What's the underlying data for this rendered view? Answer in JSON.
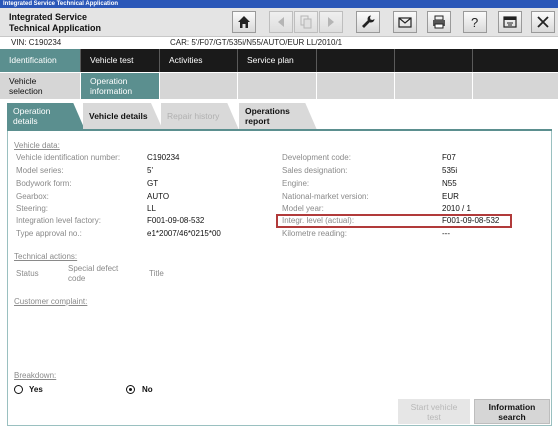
{
  "window": {
    "title": "Integrated Service Technical Application"
  },
  "header": {
    "app_line1": "Integrated Service",
    "app_line2": "Technical Application"
  },
  "vehicle": {
    "vin_text": "VIN:  C190234",
    "car_text": "CAR:  5'/F07/GT/535i/N55/AUTO/EUR LL/2010/1"
  },
  "nav1": [
    "Identification",
    "Vehicle test",
    "Activities",
    "Service plan"
  ],
  "nav2": [
    {
      "line1": "Vehicle",
      "line2": "selection"
    },
    {
      "line1": "Operation",
      "line2": "information"
    }
  ],
  "tabs": [
    {
      "line1": "Operation",
      "line2": "details"
    },
    {
      "line1": "Vehicle details",
      "line2": ""
    },
    {
      "line1": "Repair history",
      "line2": ""
    },
    {
      "line1": "Operations",
      "line2": "report"
    }
  ],
  "vehicle_data": {
    "heading": "Vehicle data:",
    "left": [
      {
        "label": "Vehicle identification number:",
        "value": "C190234"
      },
      {
        "label": "Model series:",
        "value": "5'"
      },
      {
        "label": "Bodywork form:",
        "value": "GT"
      },
      {
        "label": "Gearbox:",
        "value": "AUTO"
      },
      {
        "label": "Steering:",
        "value": "LL"
      },
      {
        "label": "Integration level factory:",
        "value": "F001-09-08-532"
      },
      {
        "label": "Type approval no.:",
        "value": "e1*2007/46*0215*00"
      }
    ],
    "right": [
      {
        "label": "Development code:",
        "value": "F07"
      },
      {
        "label": "Sales designation:",
        "value": "535i"
      },
      {
        "label": "Engine:",
        "value": "N55"
      },
      {
        "label": "National-market version:",
        "value": "EUR"
      },
      {
        "label": "Model year:",
        "value": "2010 / 1"
      },
      {
        "label": "Integr. level (actual):",
        "value": "F001-09-08-532"
      },
      {
        "label": "Kilometre reading:",
        "value": "---"
      }
    ]
  },
  "technical_actions": {
    "heading": "Technical actions:",
    "col_status": "Status",
    "col_code_1": "Special defect",
    "col_code_2": "code",
    "col_title": "Title"
  },
  "complaint": {
    "heading": "Customer complaint:"
  },
  "breakdown": {
    "heading": "Breakdown:",
    "yes": "Yes",
    "no": "No",
    "selected": "No"
  },
  "buttons": {
    "start_1": "Start vehicle",
    "start_2": "test",
    "info_1": "Information",
    "info_2": "search"
  },
  "icons": [
    "home-icon",
    "back-icon",
    "copy-icon",
    "forward-icon",
    "wrench-icon",
    "mail-icon",
    "printer-icon",
    "help-icon",
    "window-icon",
    "close-icon"
  ]
}
